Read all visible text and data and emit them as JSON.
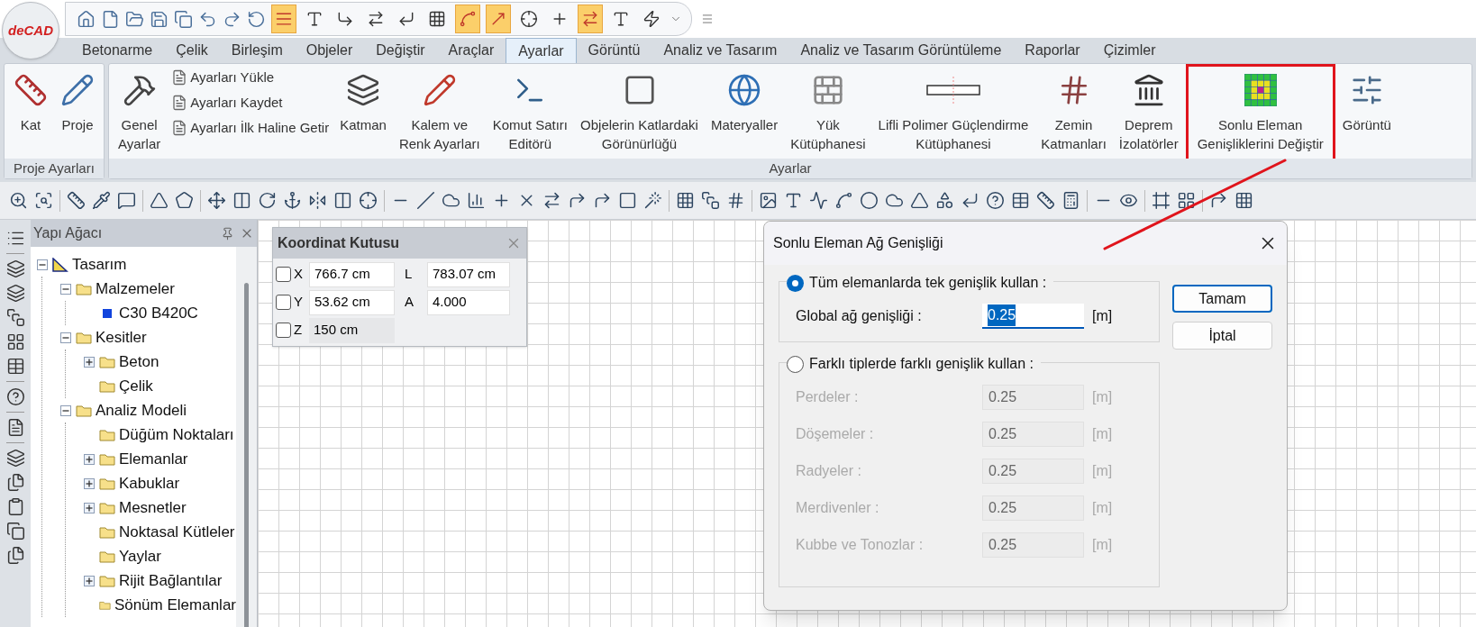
{
  "logo": {
    "text": "deCAD"
  },
  "quick_access_toggles": [
    {
      "on": true
    },
    {
      "on": false
    },
    {
      "on": false
    },
    {
      "on": false
    },
    {
      "on": false
    },
    {
      "on": false
    },
    {
      "on": true
    },
    {
      "on": true
    },
    {
      "on": false
    },
    {
      "on": false
    },
    {
      "on": true
    },
    {
      "on": false
    },
    {
      "on": false
    }
  ],
  "tabs": [
    {
      "label": "Betonarme",
      "selected": false
    },
    {
      "label": "Çelik",
      "selected": false
    },
    {
      "label": "Birleşim",
      "selected": false
    },
    {
      "label": "Objeler",
      "selected": false
    },
    {
      "label": "Değiştir",
      "selected": false
    },
    {
      "label": "Araçlar",
      "selected": false
    },
    {
      "label": "Ayarlar",
      "selected": true
    },
    {
      "label": "Görüntü",
      "selected": false
    },
    {
      "label": "Analiz ve Tasarım",
      "selected": false
    },
    {
      "label": "Analiz ve Tasarım Görüntüleme",
      "selected": false
    },
    {
      "label": "Raporlar",
      "selected": false
    },
    {
      "label": "Çizimler",
      "selected": false
    }
  ],
  "ribbon": {
    "groups": [
      {
        "label": "Proje Ayarları",
        "items": [
          {
            "kind": "large",
            "label": "Kat",
            "highlighted": false
          },
          {
            "kind": "large",
            "label": "Proje",
            "highlighted": false
          }
        ]
      },
      {
        "label": "Ayarlar",
        "items": [
          {
            "kind": "large",
            "label": "Genel\nAyarlar",
            "highlighted": false
          },
          {
            "kind": "stack",
            "entries": [
              "Ayarları Yükle",
              "Ayarları Kaydet",
              "Ayarları İlk Haline Getir"
            ]
          },
          {
            "kind": "large",
            "label": "Katman",
            "highlighted": false
          },
          {
            "kind": "large",
            "label": "Kalem ve\nRenk Ayarları",
            "highlighted": false
          },
          {
            "kind": "large",
            "label": "Komut Satırı\nEditörü",
            "highlighted": false
          },
          {
            "kind": "large",
            "label": "Objelerin Katlardaki\nGörünürlüğü",
            "highlighted": false
          },
          {
            "kind": "large",
            "label": "Materyaller",
            "highlighted": false
          },
          {
            "kind": "large",
            "label": "Yük\nKütüphanesi",
            "highlighted": false
          },
          {
            "kind": "large",
            "label": "Lifli Polimer Güçlendirme\nKütüphanesi",
            "highlighted": false
          },
          {
            "kind": "large",
            "label": "Zemin\nKatmanları",
            "highlighted": false
          },
          {
            "kind": "large",
            "label": "Deprem\nİzolatörler",
            "highlighted": false
          },
          {
            "kind": "large",
            "label": "Sonlu Eleman\nGenişliklerini Değiştir",
            "highlighted": true
          },
          {
            "kind": "large",
            "label": "Görüntü",
            "highlighted": false
          }
        ]
      }
    ]
  },
  "tree_panel": {
    "title": "Yapı Ağacı",
    "tree": [
      {
        "label": "Tasarım",
        "kind": "design",
        "has_toggle": true,
        "expanded": true,
        "children": [
          {
            "label": "Malzemeler",
            "kind": "folder",
            "has_toggle": true,
            "expanded": true,
            "children": [
              {
                "label": "C30 B420C",
                "kind": "material",
                "has_toggle": false
              }
            ]
          },
          {
            "label": "Kesitler",
            "kind": "folder",
            "has_toggle": true,
            "expanded": true,
            "children": [
              {
                "label": "Beton",
                "kind": "folder",
                "has_toggle": true,
                "expanded": false
              },
              {
                "label": "Çelik",
                "kind": "folder",
                "has_toggle": false
              }
            ]
          },
          {
            "label": "Analiz Modeli",
            "kind": "folder",
            "has_toggle": true,
            "expanded": true,
            "children": [
              {
                "label": "Düğüm Noktaları",
                "kind": "folder",
                "has_toggle": false
              },
              {
                "label": "Elemanlar",
                "kind": "folder",
                "has_toggle": true,
                "expanded": false
              },
              {
                "label": "Kabuklar",
                "kind": "folder",
                "has_toggle": true,
                "expanded": false
              },
              {
                "label": "Mesnetler",
                "kind": "folder",
                "has_toggle": true,
                "expanded": false
              },
              {
                "label": "Noktasal Kütleler",
                "kind": "folder",
                "has_toggle": false
              },
              {
                "label": "Yaylar",
                "kind": "folder",
                "has_toggle": false
              },
              {
                "label": "Rijit Bağlantılar",
                "kind": "folder",
                "has_toggle": true,
                "expanded": false
              },
              {
                "label": "Sönüm Elemanlar",
                "kind": "folder",
                "has_toggle": false
              }
            ]
          }
        ]
      }
    ]
  },
  "coordinate_box": {
    "title": "Koordinat Kutusu",
    "rows": [
      {
        "label": "X",
        "checked": false,
        "value": "766.7 cm",
        "disabled": false
      },
      {
        "label": "Y",
        "checked": false,
        "value": "53.62 cm",
        "disabled": false
      },
      {
        "label": "Z",
        "checked": false,
        "value": "150 cm",
        "disabled": true
      }
    ],
    "readouts": [
      {
        "label": "L",
        "value": "783.07 cm"
      },
      {
        "label": "A",
        "value": "4.000"
      }
    ]
  },
  "dialog": {
    "title": "Sonlu Eleman Ağ Genişliği",
    "options": [
      {
        "label": "Tüm elemanlarda tek genişlik kullan :",
        "selected": true,
        "fields": [
          {
            "label": "Global ağ genişliği :",
            "value": "0.25",
            "unit": "[m]",
            "disabled": false,
            "text_selected": true
          }
        ]
      },
      {
        "label": "Farklı tiplerde farklı genişlik kullan :",
        "selected": false,
        "fields": [
          {
            "label": "Perdeler :",
            "value": "0.25",
            "unit": "[m]",
            "disabled": true,
            "text_selected": false
          },
          {
            "label": "Döşemeler :",
            "value": "0.25",
            "unit": "[m]",
            "disabled": true,
            "text_selected": false
          },
          {
            "label": "Radyeler :",
            "value": "0.25",
            "unit": "[m]",
            "disabled": true,
            "text_selected": false
          },
          {
            "label": "Merdivenler :",
            "value": "0.25",
            "unit": "[m]",
            "disabled": true,
            "text_selected": false
          },
          {
            "label": "Kubbe ve Tonozlar :",
            "value": "0.25",
            "unit": "[m]",
            "disabled": true,
            "text_selected": false
          }
        ]
      }
    ],
    "buttons": [
      {
        "label": "Tamam",
        "default": true
      },
      {
        "label": "İptal",
        "default": false
      }
    ]
  }
}
